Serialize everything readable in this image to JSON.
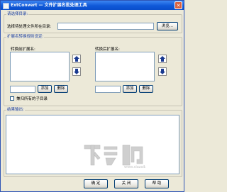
{
  "window": {
    "title": "ExtConvert — 文件扩展名批处理工具"
  },
  "dir_group": {
    "legend": "请选择目录:",
    "label": "选择待处理文件所在目录:",
    "path_value": "",
    "browse_label": "浏览..."
  },
  "rules_group": {
    "legend": "扩展名转换规则设定:",
    "before_label": "转换前扩展名:",
    "after_label": "转换后扩展名:",
    "add_label": "添加",
    "delete_label": "删除",
    "subdir_label": "兼归所有的子目录",
    "subdir_checked": false
  },
  "output_group": {
    "legend": "结果输出:"
  },
  "footer": {
    "ok_label": "确 定",
    "close_label": "关 闭",
    "help_label": "帮 助"
  },
  "watermark": {
    "text": "下载吧"
  }
}
